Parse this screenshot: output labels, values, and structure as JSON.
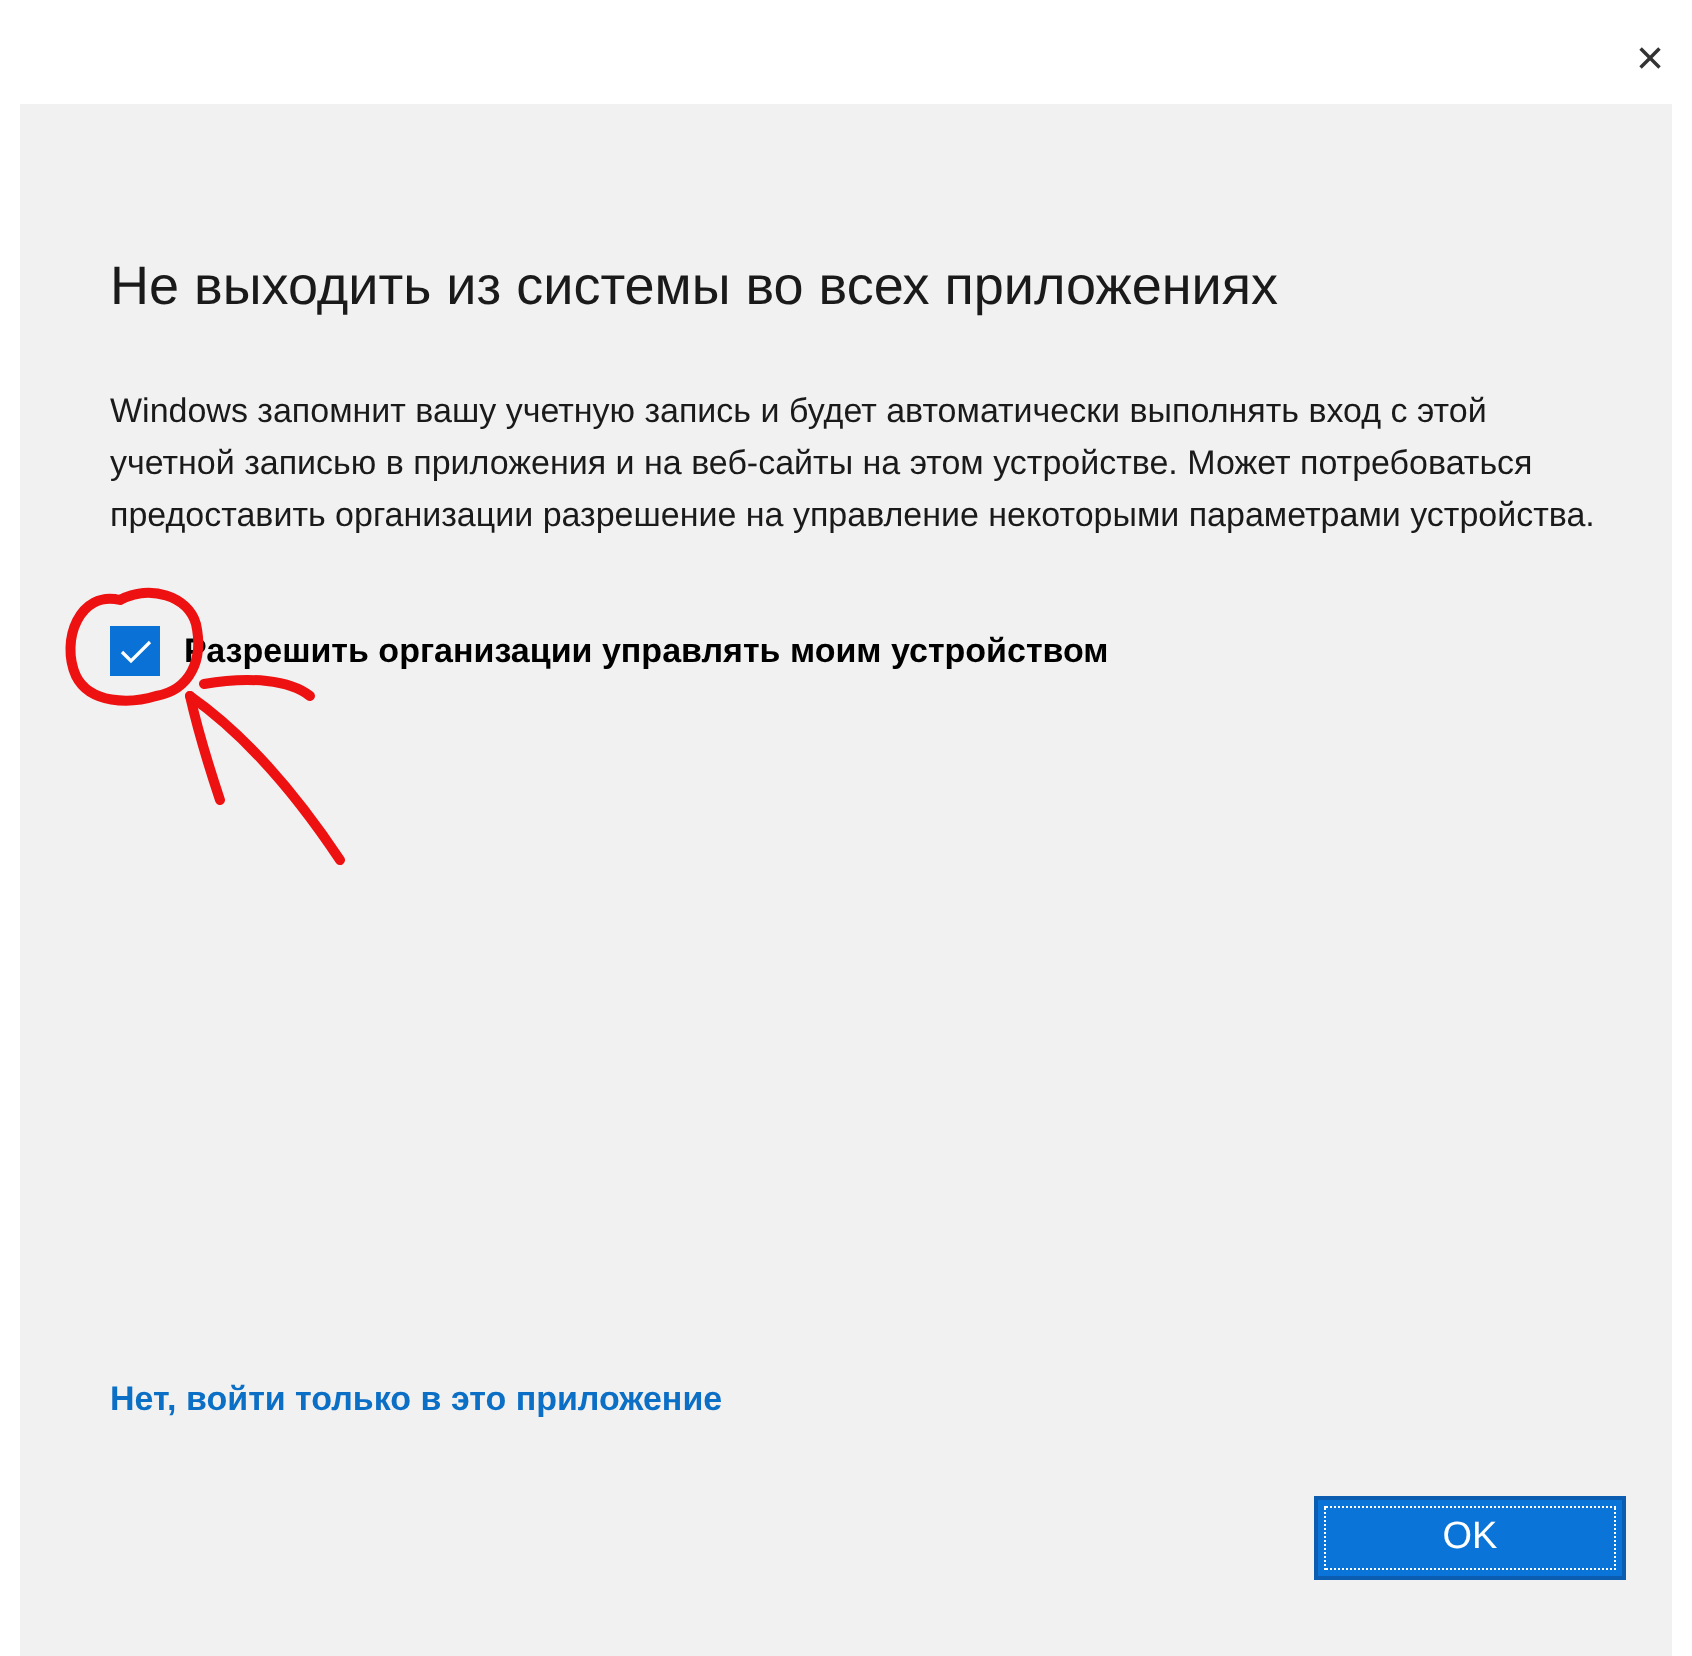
{
  "window": {
    "close": "×"
  },
  "title": "Не выходить из системы во всех приложениях",
  "description": "Windows запомнит вашу учетную запись и будет автоматически выполнять вход с этой учетной записью в приложения и на веб-сайты на этом устройстве. Может потребоваться предоставить организации разрешение на управление некоторыми параметрами устройства.",
  "checkbox": {
    "label": "Разрешить организации управлять моим устройством",
    "checked": true
  },
  "link": "Нет, войти только в это приложение",
  "buttons": [
    "OK"
  ]
}
